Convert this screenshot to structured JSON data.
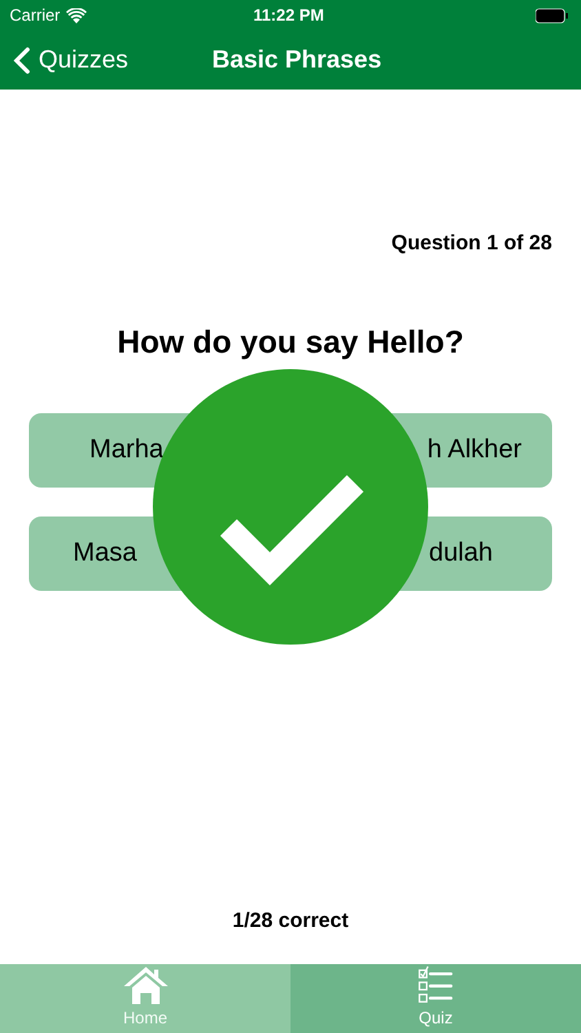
{
  "status_bar": {
    "carrier": "Carrier",
    "time": "11:22 PM"
  },
  "nav": {
    "back": "Quizzes",
    "title": "Basic Phrases"
  },
  "progress": "Question 1 of 28",
  "question": "How do you say Hello?",
  "answers": [
    {
      "text": "Marha"
    },
    {
      "text": "h Alkher"
    },
    {
      "text": "Masa"
    },
    {
      "text": "dulah"
    }
  ],
  "feedback": {
    "kind": "correct"
  },
  "score": "1/28 correct",
  "tabs": [
    {
      "label": "Home",
      "selected": false
    },
    {
      "label": "Quiz",
      "selected": true
    }
  ]
}
